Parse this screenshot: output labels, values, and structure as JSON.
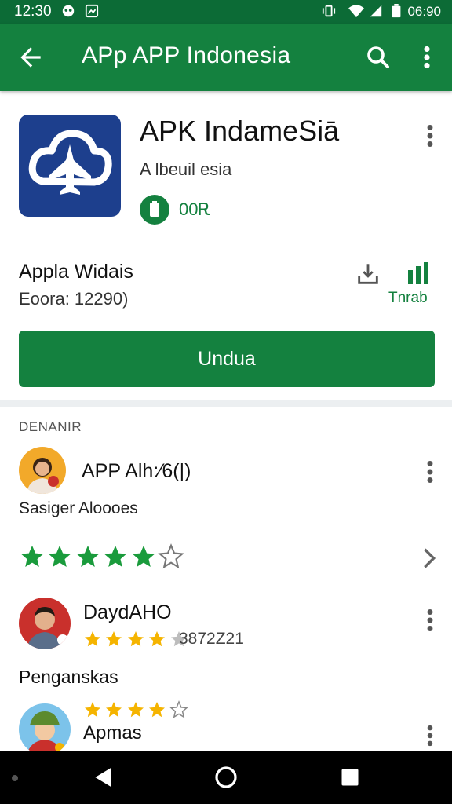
{
  "status_bar": {
    "time": "12:30",
    "right_time": "06:90",
    "icons": [
      "notification-icon",
      "image-icon",
      "vibrate-icon",
      "wifi-icon",
      "signal-icon",
      "battery-icon"
    ]
  },
  "app_bar": {
    "title": "APp APP Indonesia",
    "icons": [
      "back-arrow-icon",
      "search-icon",
      "more-vert-icon"
    ],
    "color": "#14813f"
  },
  "app": {
    "name": "APK IndameSiā",
    "developer": "A lbeuil esia",
    "badge_text": "00Ꭱ",
    "icon": "cloud-plane-icon",
    "icon_color": "#1d3f8d"
  },
  "meta": {
    "title": "Appla Widais",
    "subtitle": "Eoora: 12290)",
    "side_label": "Tnrab",
    "icons": [
      "download-icon",
      "bar-chart-icon"
    ]
  },
  "install_button": {
    "label": "Undua",
    "color": "#14813f"
  },
  "developer_section": {
    "label": "DENANIR",
    "name": "APP Alh:⁄6(|)",
    "subtitle": "Sasiger Aloooes",
    "avatar": "person-avatar"
  },
  "rating": {
    "stars": 4.5,
    "star_color": "#1a9b3c",
    "icon": "chevron-right-icon"
  },
  "reviews": [
    {
      "name": "DaydAHO",
      "stars": 4,
      "count": "3872Z21",
      "text": "Penganskas",
      "star_color": "#f5b400"
    },
    {
      "name": "Apmas",
      "stars": 4,
      "star_color": "#f5b400"
    }
  ],
  "nav_bar": {
    "icons": [
      "back-triangle-icon",
      "home-circle-icon",
      "recents-square-icon"
    ]
  }
}
